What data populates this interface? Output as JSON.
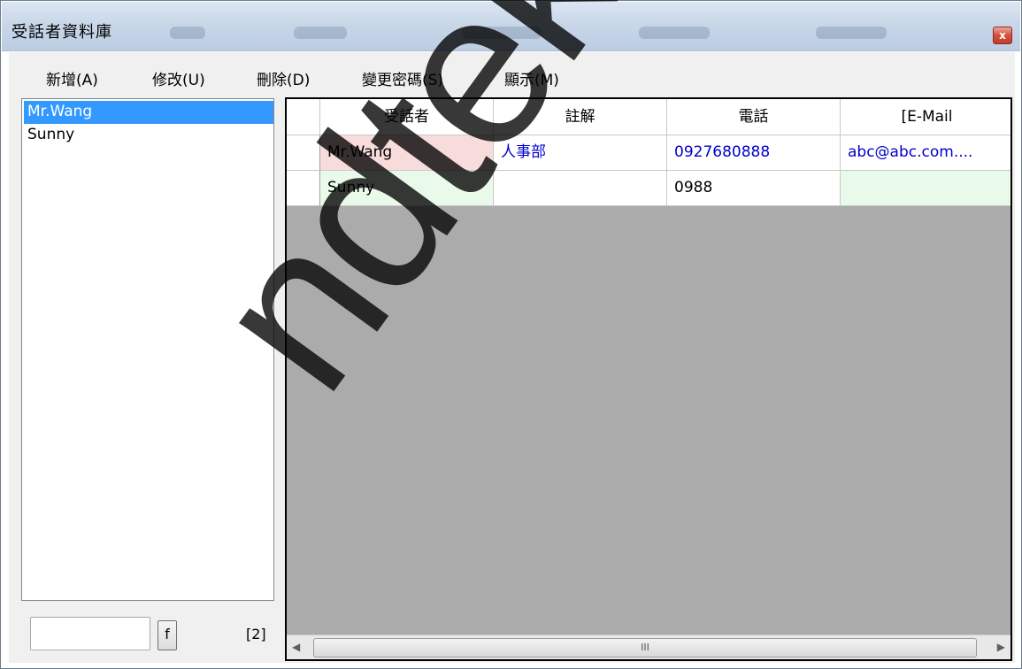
{
  "window": {
    "title": "受話者資料庫",
    "close_glyph": "x"
  },
  "menu": [
    {
      "label": "新增(A)"
    },
    {
      "label": "修改(U)"
    },
    {
      "label": "刪除(D)"
    },
    {
      "label": "變更密碼(S)"
    },
    {
      "label": "顯示(M)"
    }
  ],
  "list": {
    "items": [
      "Mr.Wang",
      "Sunny"
    ],
    "selected": "Mr.Wang"
  },
  "search": {
    "value": "",
    "button_label": "f",
    "count": "[2]"
  },
  "grid": {
    "columns": [
      "受話者",
      "註解",
      "電話",
      "[E-Mail"
    ],
    "rows": [
      {
        "name": "Mr.Wang",
        "note": "人事部",
        "phone": "0927680888",
        "email": "abc@abc.com...."
      },
      {
        "name": "Sunny",
        "note": "",
        "phone": "0988",
        "email": ""
      }
    ],
    "scrollbar_grip": "III"
  },
  "watermark": {
    "text": "ndtek"
  },
  "colors": {
    "selection": "#3399ff",
    "row1_name_bg": "#f8dcdc",
    "row2_bg": "#eafaea",
    "link_text": "#0000cc",
    "grid_empty": "#ababab"
  }
}
